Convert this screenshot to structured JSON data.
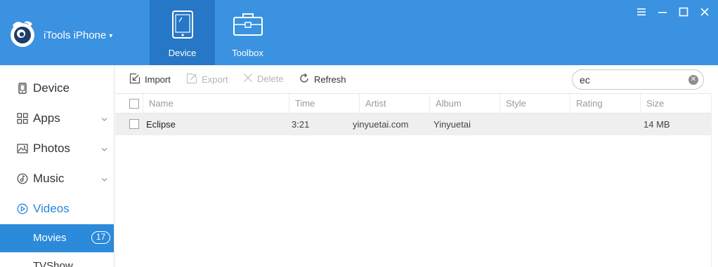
{
  "app": {
    "name": "iTools iPhone",
    "caret": "▾"
  },
  "nav_tabs": [
    {
      "label": "Device",
      "icon": "tablet-icon",
      "active": true
    },
    {
      "label": "Toolbox",
      "icon": "toolbox-icon",
      "active": false
    }
  ],
  "window_controls": [
    "menu-icon",
    "minimize-icon",
    "maximize-icon",
    "close-icon"
  ],
  "sidebar": {
    "items": [
      {
        "label": "Device",
        "icon": "phone-icon",
        "expandable": false
      },
      {
        "label": "Apps",
        "icon": "apps-grid-icon",
        "expandable": true
      },
      {
        "label": "Photos",
        "icon": "photo-icon",
        "expandable": true
      },
      {
        "label": "Music",
        "icon": "music-icon",
        "expandable": true
      },
      {
        "label": "Videos",
        "icon": "play-circle-icon",
        "expandable": false,
        "selected": true
      }
    ],
    "sub_items": [
      {
        "label": "Movies",
        "count": "17",
        "active": true
      },
      {
        "label": "TVShow",
        "active": false
      }
    ]
  },
  "toolbar": {
    "import_label": "Import",
    "export_label": "Export",
    "delete_label": "Delete",
    "refresh_label": "Refresh"
  },
  "search": {
    "value": "ec"
  },
  "table": {
    "columns": [
      "Name",
      "Time",
      "Artist",
      "Album",
      "Style",
      "Rating",
      "Size"
    ],
    "rows": [
      {
        "name": "Eclipse",
        "time": "3:21",
        "artist": "yinyuetai.com",
        "album": "Yinyuetai",
        "style": "",
        "rating": "",
        "size": "14 MB"
      }
    ]
  },
  "colors": {
    "titlebar": "#3a92e0",
    "active_tab": "#2677c6",
    "sidebar_active": "#2b8ad9",
    "accent_text": "#2a86d9",
    "row_highlight": "#efefef"
  }
}
